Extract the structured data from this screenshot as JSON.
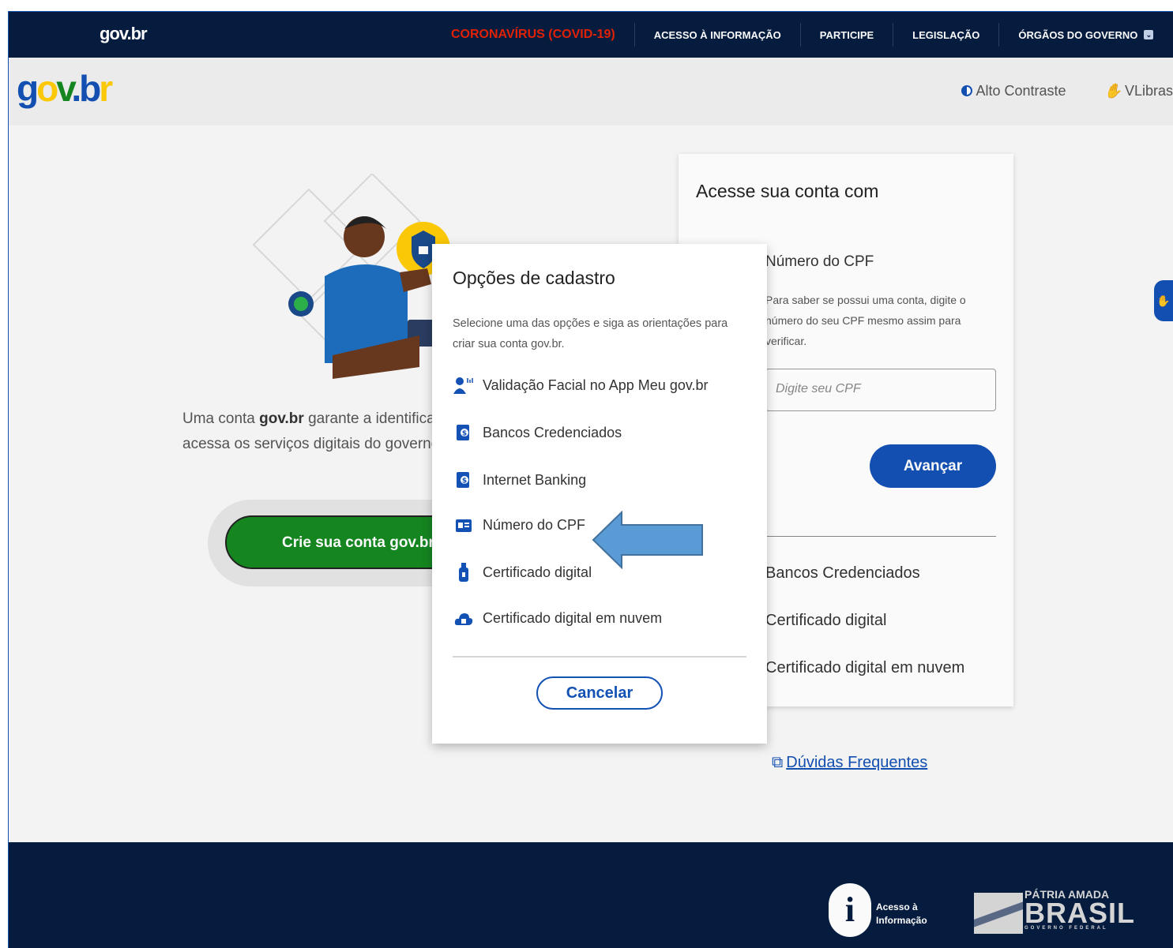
{
  "topbar": {
    "logo": "gov.br",
    "nav": [
      "CORONAVÍRUS (COVID-19)",
      "ACESSO À INFORMAÇÃO",
      "PARTICIPE",
      "LEGISLAÇÃO",
      "ÓRGÃOS DO GOVERNO"
    ]
  },
  "header": {
    "logo_parts": [
      "g",
      "o",
      "v",
      ".",
      "b",
      "r"
    ],
    "high_contrast": "Alto Contraste",
    "vlibras": "VLibras"
  },
  "main": {
    "tagline_prefix": "Uma conta ",
    "tagline_bold": "gov.br",
    "tagline_rest": " garante a identificação de cada cidadão que acessa os serviços digitais do governo.",
    "create_button": "Crie sua conta gov.br"
  },
  "login_card": {
    "title": "Acesse sua conta com",
    "subtitle": "Número do CPF",
    "description": "Para saber se possui uma conta, digite o número do seu CPF mesmo assim para verificar.",
    "input_placeholder": "Digite seu CPF",
    "advance_button": "Avançar",
    "options": [
      "Bancos Credenciados",
      "Certificado digital",
      "Certificado digital em nuvem"
    ]
  },
  "faq_link": "Dúvidas Frequentes",
  "modal": {
    "title": "Opções de cadastro",
    "description": "Selecione uma das opções e siga as orientações para criar sua conta gov.br.",
    "items": [
      {
        "label": "Validação Facial no App Meu gov.br",
        "icon": "face-id-icon"
      },
      {
        "label": "Bancos Credenciados",
        "icon": "bank-icon"
      },
      {
        "label": "Internet Banking",
        "icon": "internet-banking-icon"
      },
      {
        "label": "Número do CPF",
        "icon": "id-card-icon"
      },
      {
        "label": "Certificado digital",
        "icon": "usb-token-icon"
      },
      {
        "label": "Certificado digital em nuvem",
        "icon": "cloud-icon"
      }
    ],
    "cancel": "Cancelar"
  },
  "footer": {
    "access_info_line1": "Acesso à",
    "access_info_line2": "Informação",
    "brasil_line1": "PÁTRIA AMADA",
    "brasil_line2": "BRASIL",
    "brasil_line3": "GOVERNO FEDERAL"
  },
  "colors": {
    "dark_navy": "#071d41",
    "primary_blue": "#1351b4",
    "green": "#168821",
    "covid_red": "#e52207",
    "arrow_blue": "#5b9bd5"
  }
}
